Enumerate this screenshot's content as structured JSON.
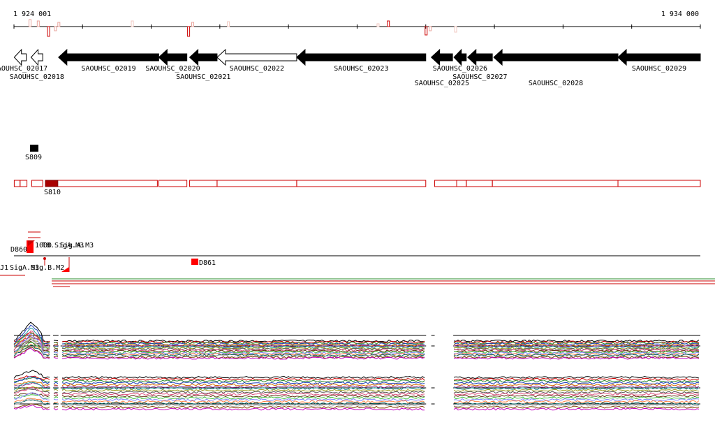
{
  "ruler": {
    "start_label": "1 924 001",
    "end_label": "1 934 000",
    "start": 1924001,
    "end": 1934000,
    "ticks": [
      1924001,
      1925000,
      1926000,
      1927000,
      1928000,
      1929000,
      1930000,
      1931000,
      1932000,
      1933000,
      1934000
    ],
    "signal_marks": [
      {
        "pos": 1924230,
        "h": 10,
        "dir": "up",
        "color": "#e8a29a"
      },
      {
        "pos": 1924350,
        "h": 8,
        "dir": "up",
        "color": "#e8a29a"
      },
      {
        "pos": 1924500,
        "h": 14,
        "dir": "down",
        "color": "#cc0000"
      },
      {
        "pos": 1924600,
        "h": 6,
        "dir": "down",
        "color": "#e8a29a"
      },
      {
        "pos": 1924650,
        "h": 6,
        "dir": "up",
        "color": "#e8a29a"
      },
      {
        "pos": 1925720,
        "h": 8,
        "dir": "up",
        "color": "#f0c8c0"
      },
      {
        "pos": 1926540,
        "h": 14,
        "dir": "down",
        "color": "#cc0000"
      },
      {
        "pos": 1926600,
        "h": 6,
        "dir": "up",
        "color": "#e8a29a"
      },
      {
        "pos": 1927120,
        "h": 7,
        "dir": "up",
        "color": "#f0c8c0"
      },
      {
        "pos": 1929300,
        "h": 4,
        "dir": "up",
        "color": "#f0c8c0"
      },
      {
        "pos": 1929450,
        "h": 8,
        "dir": "up",
        "color": "#cc0000"
      },
      {
        "pos": 1930000,
        "h": 12,
        "dir": "down",
        "color": "#cc0000"
      },
      {
        "pos": 1930060,
        "h": 6,
        "dir": "down",
        "color": "#e8a29a"
      },
      {
        "pos": 1930430,
        "h": 8,
        "dir": "down",
        "color": "#f0c8c0"
      }
    ]
  },
  "genes": [
    {
      "id": "SAOUHSC_02017",
      "start": 1924005,
      "end": 1924180,
      "fill": "white",
      "label_row": 0
    },
    {
      "id": "SAOUHSC_02018",
      "start": 1924250,
      "end": 1924420,
      "fill": "white",
      "label_row": 1
    },
    {
      "id": "SAOUHSC_02019",
      "start": 1924650,
      "end": 1926110,
      "fill": "black",
      "label_row": 0
    },
    {
      "id": "SAOUHSC_02020",
      "start": 1926110,
      "end": 1926520,
      "fill": "black",
      "label_row": 0
    },
    {
      "id": "SAOUHSC_02021",
      "start": 1926560,
      "end": 1926960,
      "fill": "black",
      "label_row": 1
    },
    {
      "id": "SAOUHSC_02022",
      "start": 1926960,
      "end": 1928120,
      "fill": "white",
      "label_row": 0
    },
    {
      "id": "SAOUHSC_02023",
      "start": 1928120,
      "end": 1930000,
      "fill": "black",
      "label_row": 0
    },
    {
      "id": "SAOUHSC_02025",
      "start": 1930080,
      "end": 1930390,
      "fill": "black",
      "label_row": 2
    },
    {
      "id": "SAOUHSC_02026",
      "start": 1930410,
      "end": 1930590,
      "fill": "black",
      "label_row": 0
    },
    {
      "id": "SAOUHSC_02027",
      "start": 1930610,
      "end": 1930970,
      "fill": "black",
      "label_row": 1
    },
    {
      "id": "SAOUHSC_02028",
      "start": 1930990,
      "end": 1932800,
      "fill": "black",
      "label_row": 2
    },
    {
      "id": "SAOUHSC_02029",
      "start": 1932800,
      "end": 1934000,
      "fill": "black",
      "label_row": 0
    }
  ],
  "features": {
    "s809": {
      "label": "S809",
      "start": 1924235,
      "end": 1924360
    },
    "s810": {
      "label": "S810",
      "start": 1924460,
      "end": 1924640
    },
    "segments": [
      [
        1924005,
        1924090
      ],
      [
        1924090,
        1924190
      ],
      [
        1924260,
        1924420
      ],
      [
        1924460,
        1926090
      ],
      [
        1926110,
        1926520
      ],
      [
        1926560,
        1926960
      ],
      [
        1926960,
        1928120
      ],
      [
        1928120,
        1930000
      ],
      [
        1930130,
        1930450
      ],
      [
        1930450,
        1930590
      ],
      [
        1930590,
        1930970
      ],
      [
        1930970,
        1932800
      ],
      [
        1932800,
        1934000
      ]
    ]
  },
  "regulators": {
    "d860_label": "D860",
    "d861_label": "D861",
    "label_a": "1000",
    "label_b": "T8.SigA.M3",
    "label_c": "Sig.A.M3",
    "label_d": "J1",
    "label_e": "SigA.M3",
    "label_f": "Sig.B.M2"
  },
  "expression": {
    "gaps": [
      [
        1924530,
        1924570
      ],
      [
        1924650,
        1924680
      ],
      [
        1930005,
        1930080
      ],
      [
        1930130,
        1930400
      ]
    ],
    "series_colors": [
      "#000000",
      "#cc0000",
      "#2a8a2a",
      "#1f3fbf",
      "#d46c00",
      "#8a2a8a",
      "#2aa0a0",
      "#a0a020",
      "#555555",
      "#e05080",
      "#603010",
      "#40c040",
      "#8080ff",
      "#ff8040",
      "#006060",
      "#b0b0b0",
      "#804000",
      "#c000c0"
    ]
  }
}
